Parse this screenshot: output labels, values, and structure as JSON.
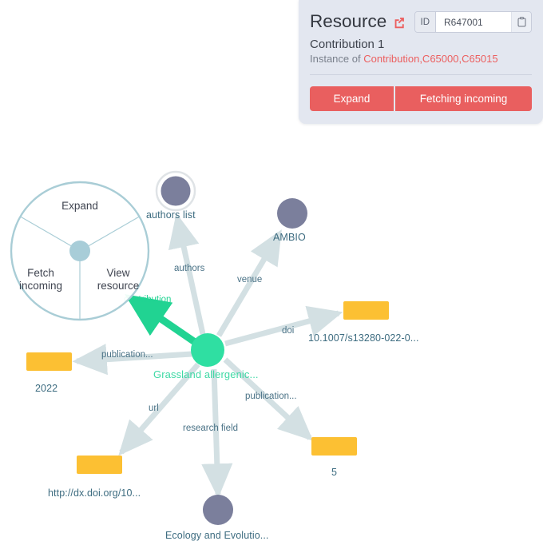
{
  "card": {
    "title": "Resource",
    "external_link_icon": "external-link-icon",
    "id_label": "ID",
    "id_value": "R647001",
    "copy_icon": "clipboard-copy-icon",
    "subtitle": "Contribution 1",
    "instance_prefix": "Instance of ",
    "instance_links": "Contribution,C65000,C65015",
    "buttons": {
      "expand": "Expand",
      "fetch": "Fetching incoming"
    },
    "colors": {
      "card_bg": "#e3e7f0",
      "button": "#e95f5f",
      "link": "#ec5f5f"
    }
  },
  "radial_menu": {
    "items": [
      {
        "label": "Expand"
      },
      {
        "label": "Fetch\nincoming",
        "line1": "Fetch",
        "line2": "incoming"
      },
      {
        "label": "View\nresource",
        "line1": "View",
        "line2": "resource"
      }
    ],
    "ring_color": "#a9cdd6",
    "hub_color": "#a8cdd8"
  },
  "graph": {
    "center_node": {
      "label": "Grassland allergenic...",
      "color": "#2fdfa2"
    },
    "nodes": [
      {
        "id": "authors-list",
        "label": "authors list",
        "shape": "circle-double",
        "color": "#7b7f9c"
      },
      {
        "id": "ambio",
        "label": "AMBIO",
        "shape": "circle",
        "color": "#7b7f9c"
      },
      {
        "id": "doi",
        "label": "10.1007/s13280-022-0...",
        "shape": "rect",
        "color": "#fcc033"
      },
      {
        "id": "pages",
        "label": "5",
        "shape": "rect",
        "color": "#fcc033"
      },
      {
        "id": "ecology",
        "label": "Ecology and Evolutio...",
        "shape": "circle",
        "color": "#7b7f9c"
      },
      {
        "id": "url",
        "label": "http://dx.doi.org/10...",
        "shape": "rect",
        "color": "#fcc033"
      },
      {
        "id": "year",
        "label": "2022",
        "shape": "rect",
        "color": "#fcc033"
      }
    ],
    "edges": [
      {
        "id": "contribution",
        "label": "contribution",
        "active": true
      },
      {
        "id": "authors",
        "label": "authors",
        "active": false
      },
      {
        "id": "venue",
        "label": "venue",
        "active": false
      },
      {
        "id": "doi",
        "label": "doi",
        "active": false
      },
      {
        "id": "publication-r",
        "label": "publication...",
        "active": false
      },
      {
        "id": "research",
        "label": "research field",
        "active": false
      },
      {
        "id": "url",
        "label": "url",
        "active": false
      },
      {
        "id": "publication-l",
        "label": "publication...",
        "active": false
      }
    ],
    "edge_color": "#d3e0e3",
    "active_edge_color": "#21d392"
  }
}
